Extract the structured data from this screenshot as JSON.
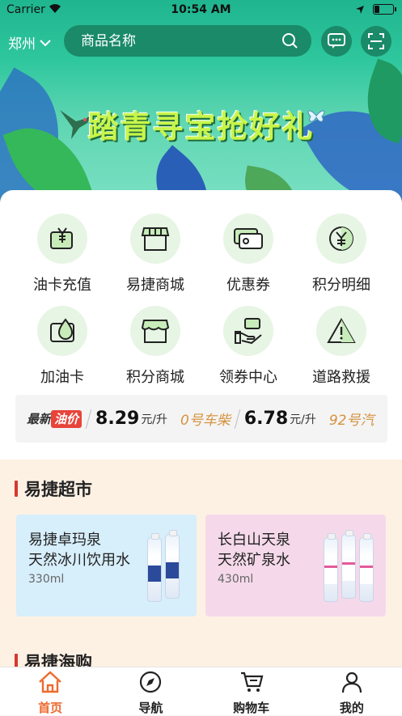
{
  "status": {
    "carrier": "Carrier",
    "time": "10:54 AM"
  },
  "top": {
    "city": "郑州",
    "search_placeholder": "商品名称"
  },
  "banner": {
    "title": "踏青寻宝抢好礼"
  },
  "grid": [
    {
      "label": "油卡充值",
      "icon": "fuel-card-yuan-icon"
    },
    {
      "label": "易捷商城",
      "icon": "store-icon"
    },
    {
      "label": "优惠券",
      "icon": "coupon-icon"
    },
    {
      "label": "积分明细",
      "icon": "yuan-coin-icon"
    },
    {
      "label": "加油卡",
      "icon": "fuel-card-icon"
    },
    {
      "label": "积分商城",
      "icon": "points-store-icon"
    },
    {
      "label": "领券中心",
      "icon": "coupon-center-icon"
    },
    {
      "label": "道路救援",
      "icon": "warning-icon"
    }
  ],
  "price_ticker": {
    "badge_left": "最新",
    "badge_right": "油价",
    "items": [
      {
        "value": "8.29",
        "unit": "元/升"
      },
      {
        "name": "0号车柴",
        "value": "6.78",
        "unit": "元/升"
      },
      {
        "name": "92号汽"
      }
    ]
  },
  "supermarket": {
    "title": "易捷超市",
    "products": [
      {
        "line1": "易捷卓玛泉",
        "line2": "天然冰川饮用水",
        "volume": "330ml"
      },
      {
        "line1": "长白山天泉",
        "line2": "天然矿泉水",
        "volume": "430ml"
      }
    ]
  },
  "next_section": {
    "title": "易捷海购"
  },
  "tabs": [
    {
      "label": "首页",
      "icon": "home-icon",
      "active": true
    },
    {
      "label": "导航",
      "icon": "compass-icon"
    },
    {
      "label": "购物车",
      "icon": "cart-icon"
    },
    {
      "label": "我的",
      "icon": "user-icon"
    }
  ],
  "colors": {
    "brand_green": "#1a8a68",
    "accent_orange": "#ee6a2f",
    "icon_bg": "#e7f5e4",
    "section_bar": "#d43a2f"
  }
}
